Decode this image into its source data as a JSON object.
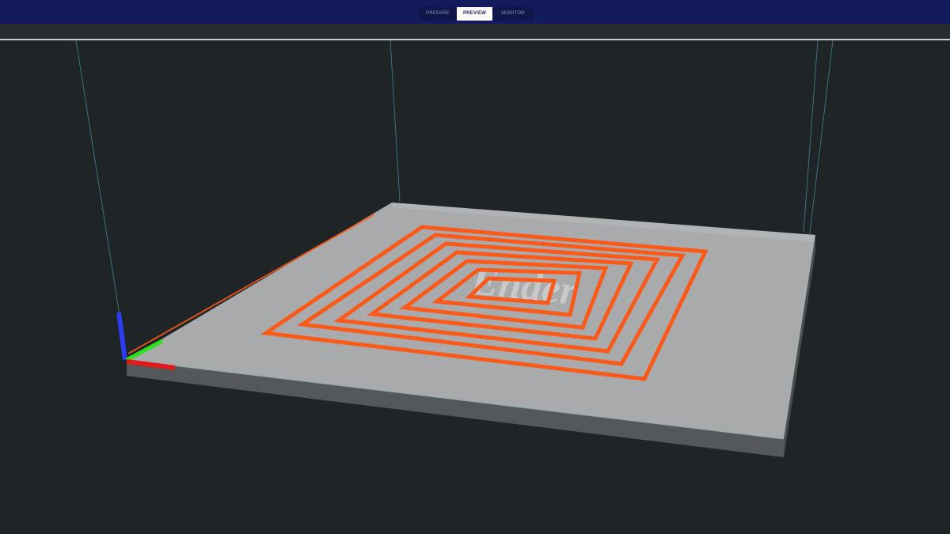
{
  "header": {
    "tabs": [
      {
        "id": "prepare",
        "label": "PREPARE",
        "active": false
      },
      {
        "id": "preview",
        "label": "PREVIEW",
        "active": true
      },
      {
        "id": "monitor",
        "label": "MONITOR",
        "active": false
      }
    ]
  },
  "viewport": {
    "plate_logo": "Ender",
    "toolpath": {
      "color": "#ff5a1a",
      "rings": 7
    },
    "axes": {
      "x_color": "#e01919",
      "y_color": "#2fe01e",
      "z_color": "#2b3cf5"
    },
    "colors": {
      "background": "#1f2427",
      "plate": "#a9abad",
      "plate_edge": "#5f6366",
      "build_volume_line": "#3f7f8f"
    }
  }
}
